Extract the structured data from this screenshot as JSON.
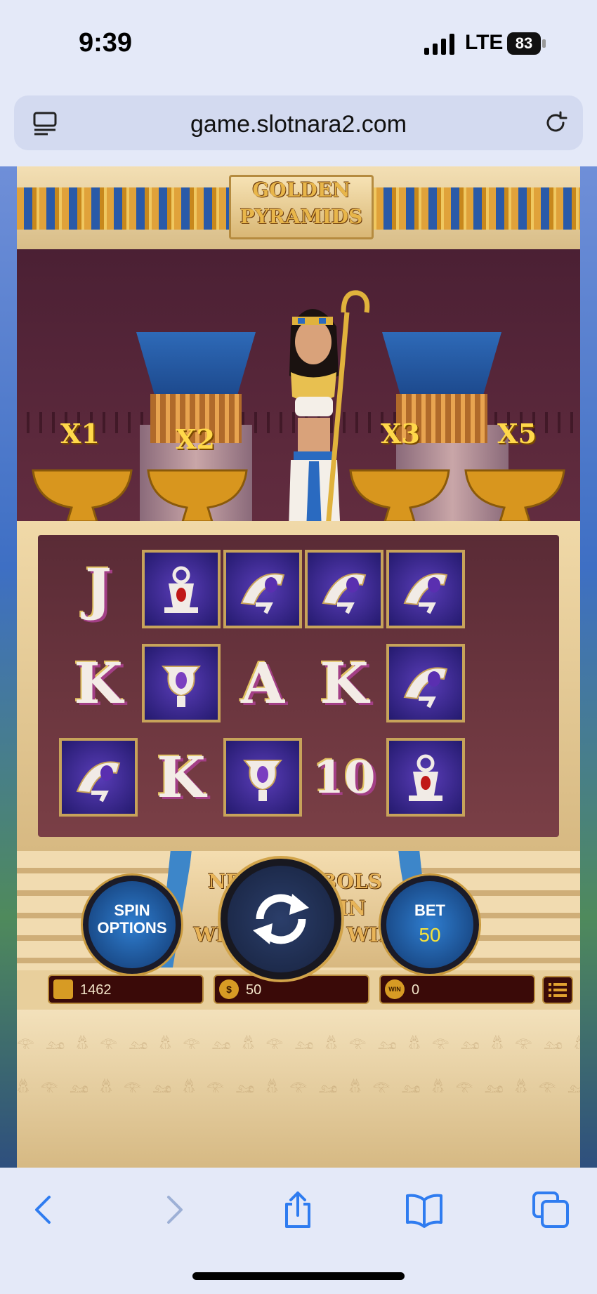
{
  "status_bar": {
    "time": "9:39",
    "network": "LTE",
    "battery": "83"
  },
  "browser": {
    "url": "game.slotnara2.com"
  },
  "game": {
    "logo": {
      "line1": "GOLDEN",
      "line2": "PYRAMIDS"
    },
    "multipliers": [
      "X1",
      "X2",
      "X3",
      "X5"
    ],
    "reels": [
      [
        {
          "symbol": "J",
          "boxed": false
        },
        {
          "symbol": "red-vase",
          "boxed": true
        },
        {
          "symbol": "eye",
          "boxed": true
        },
        {
          "symbol": "eye",
          "boxed": true
        },
        {
          "symbol": "eye",
          "boxed": true
        }
      ],
      [
        {
          "symbol": "K",
          "boxed": false
        },
        {
          "symbol": "amulet",
          "boxed": true
        },
        {
          "symbol": "A",
          "boxed": false
        },
        {
          "symbol": "K",
          "boxed": false
        },
        {
          "symbol": "eye",
          "boxed": true
        }
      ],
      [
        {
          "symbol": "eye",
          "boxed": true
        },
        {
          "symbol": "K",
          "boxed": false
        },
        {
          "symbol": "amulet",
          "boxed": true
        },
        {
          "symbol": "10",
          "boxed": false
        },
        {
          "symbol": "red-vase",
          "boxed": true
        }
      ]
    ],
    "banner": {
      "line1": "NEW SYMBOLS",
      "line2": "CASCADE IN",
      "line3": "WITH EVERY WIN"
    },
    "balance": "1462",
    "bet_amount": "50",
    "win": "0",
    "coin_icon_label": "$",
    "win_icon_label": "WIN",
    "spin_options": {
      "line1": "SPIN",
      "line2": "OPTIONS"
    },
    "bet_button": {
      "label": "BET",
      "value": "50"
    }
  },
  "colors": {
    "gold": "#e8b64a",
    "accent_blue": "#2f7ed0",
    "bet_value": "#f5e23c"
  }
}
